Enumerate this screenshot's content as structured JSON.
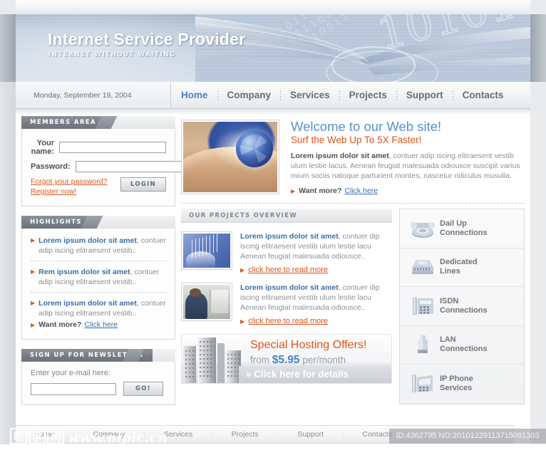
{
  "banner": {
    "title": "Internet Service Provider",
    "tagline": "INTERNET WITHOUT WAITING"
  },
  "topbar": {
    "date": "Monday, September 19, 2004",
    "nav": [
      {
        "label": "Home",
        "active": true
      },
      {
        "label": "Company",
        "active": false
      },
      {
        "label": "Services",
        "active": false
      },
      {
        "label": "Projects",
        "active": false
      },
      {
        "label": "Support",
        "active": false
      },
      {
        "label": "Contacts",
        "active": false
      }
    ]
  },
  "sidebar": {
    "members": {
      "title": "MEMBERS AREA",
      "name_label": "Your name:",
      "name_value": "",
      "password_label": "Password:",
      "password_value": "",
      "forgot_link": "Forgot your password?",
      "register_link": "Register now!",
      "login_button": "LOGIN"
    },
    "highlights": {
      "title": "HIGHLIGHTS",
      "items": [
        {
          "bold": "Lorem ipsum dolor sit amet",
          "rest": ",",
          "tail": "contuer adip iscing elitraesent vestib.."
        },
        {
          "bold": "Rem ipsum dolor sit amet",
          "rest": ", contuer",
          "tail": "adip iscing elitraesent vestib.."
        },
        {
          "bold": "Lorem ipsum dolor sit amet",
          "rest": ",",
          "tail": "contuer adip iscing elitraesent vestib.."
        }
      ],
      "more_label": "Want more?",
      "more_link": "Click here"
    },
    "newsletter": {
      "title": "SIGN UP FOR NEWSLETTER",
      "label": "Enter your e-mail here:",
      "value": "",
      "button": "GO!"
    }
  },
  "main": {
    "welcome": {
      "title": "Welcome to our Web site!",
      "subtitle": "Surf the Web Up To 5X Faster!",
      "body_bold": "Lorem ipsum dolor sit amet",
      "body_rest": ", contuer adip iscing elitraesent vestib ulum lestie lacus. Aenean  feugiat malesuada odiousce suscipit varius mium sociis natoque parturient montes, nascetur ridiculus musulla.",
      "more_label": "Want more?",
      "more_link": "Click here"
    },
    "projects": {
      "bar_title": "OUR PROJECTS OVERVIEW",
      "items": [
        {
          "bold": "Lorem ipsum dolor sit amet",
          "rest": ", contuer dip iscing elitraesent vestib ulum lestie lacu Aenean  feugiat malesuada odiousce..",
          "link": "click here to read more",
          "thumb": "network-thumb"
        },
        {
          "bold": "Lorem ipsum dolor sit amet",
          "rest": ", contuer dip iscing elitraesent vestib ulum lestie lacu Aenean  feugiat malesuada odiousce..",
          "link": "click here to read more",
          "thumb": "operator-thumb"
        }
      ]
    },
    "services": [
      {
        "label": "Dail Up\nConnections",
        "icon": "telephone-icon"
      },
      {
        "label": "Dedicated\nLines",
        "icon": "server-rack-icon"
      },
      {
        "label": "ISDN\nConnections",
        "icon": "isdn-phone-icon"
      },
      {
        "label": "LAN\nConnections",
        "icon": "rj45-plug-icon"
      },
      {
        "label": "IP Phone\nServices",
        "icon": "ip-phone-icon"
      }
    ],
    "hosting": {
      "title": "Special Hosting Offers!",
      "price_prefix": "from",
      "price": "$5.95",
      "price_suffix": "per/month",
      "cta": "» Click here for details"
    }
  },
  "footer": {
    "nav": [
      "Home",
      "Company",
      "Services",
      "Projects",
      "Support",
      "Contacts"
    ],
    "separator": ":"
  },
  "watermark": {
    "site": "www.nipic.cn",
    "id_text": "ID:4362795 NO:20101229113715061303"
  },
  "colors": {
    "accent_blue": "#4a82c4",
    "accent_orange": "#e0521b",
    "heading_blue": "#5b8fd0",
    "link_blue": "#3a6ea8",
    "panel_head": "#787e85",
    "muted_text": "#8b9097"
  }
}
